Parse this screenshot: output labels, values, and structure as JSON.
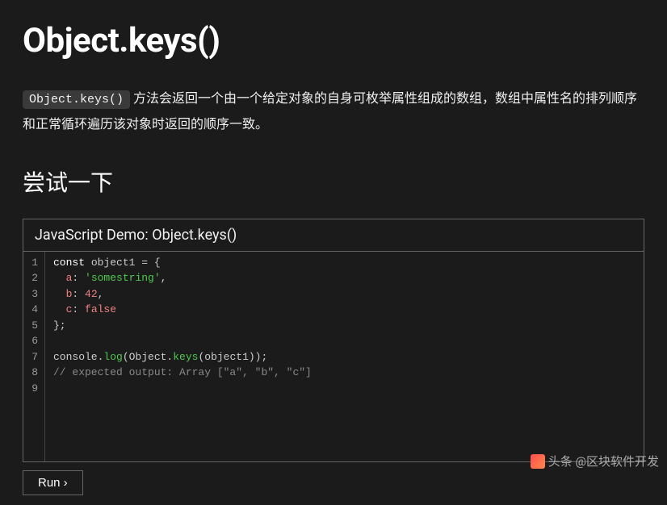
{
  "page": {
    "title": "Object.keys()",
    "inline_code": "Object.keys()",
    "description_rest": " 方法会返回一个由一个给定对象的自身可枚举属性组成的数组，数组中属性名的排列顺序和正常循环遍历该对象时返回的顺序一致。",
    "try_heading": "尝试一下"
  },
  "demo": {
    "header": "JavaScript Demo: Object.keys()",
    "line_numbers": [
      "1",
      "2",
      "3",
      "4",
      "5",
      "6",
      "7",
      "8",
      "9"
    ],
    "code": {
      "l1_kw": "const",
      "l1_rest": " object1 = {",
      "l2_prop": "a",
      "l2_str": "'somestring'",
      "l3_prop": "b",
      "l3_num": "42",
      "l4_prop": "c",
      "l4_bool": "false",
      "l5": "};",
      "l7_a": "console.",
      "l7_fn1": "log",
      "l7_b": "(Object.",
      "l7_fn2": "keys",
      "l7_c": "(object1));",
      "l8_comment": "// expected output: Array [\"a\", \"b\", \"c\"]"
    },
    "run_label": "Run ›"
  },
  "watermark": {
    "text": "头条 @区块软件开发"
  }
}
